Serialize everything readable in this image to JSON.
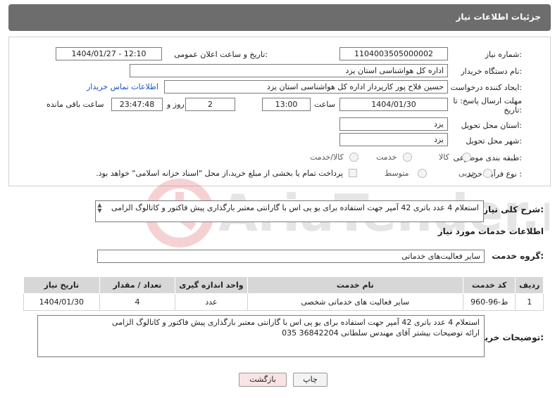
{
  "header": {
    "title": "جزئیات اطلاعات نیاز"
  },
  "form": {
    "need_number": {
      "label": "شماره نیاز:",
      "value": "1104003505000002"
    },
    "announce_datetime": {
      "label": "تاریخ و ساعت اعلان عمومی:",
      "value": "1404/01/27 - 12:10"
    },
    "buyer_org": {
      "label": "نام دستگاه خریدار:",
      "value": "اداره کل هواشناسی استان یزد"
    },
    "requester": {
      "label": "ایجاد کننده درخواست:",
      "value": "حسین  فلاح پور کارپرداز اداره کل هواشناسی استان یزد",
      "contact_link": "اطلاعات تماس خریدار"
    },
    "deadline": {
      "label_line1": "مهلت ارسال پاسخ: تا",
      "label_line2": "تاریخ:",
      "date": "1404/01/30",
      "time_label": "ساعت",
      "time": "13:00",
      "days": "2",
      "days_label": "روز و",
      "remaining": "23:47:48",
      "remaining_label": "ساعت باقی مانده"
    },
    "delivery_province": {
      "label": "استان محل تحویل:",
      "value": "یزد"
    },
    "delivery_city": {
      "label": "شهر محل تحویل:",
      "value": "یزد"
    },
    "category": {
      "label": "طبقه بندی موضوعی:",
      "options": [
        "کالا",
        "خدمت",
        "کالا/خدمت"
      ]
    },
    "process_type": {
      "label": "نوع فرآیند خرید :",
      "options": [
        "جزیی",
        "متوسط"
      ],
      "payment_note": "پرداخت تمام یا بخشی از مبلغ خرید،از محل \"اسناد خزانه اسلامی\" خواهد بود."
    }
  },
  "summary": {
    "label": "شرح کلی نیاز:",
    "text": "استعلام 4 عدد باتری 42 آمپر  جهت استفاده برای یو پی اس با گارانتی معتبر بارگذاری پیش فاکتور و کاتالوگ الزامی"
  },
  "services_section": {
    "title": "اطلاعات خدمات مورد نیاز",
    "group_label": "گروه خدمت:",
    "group_value": "سایر فعالیت‌های خدماتی"
  },
  "table": {
    "headers": [
      "ردیف",
      "کد خدمت",
      "نام خدمت",
      "واحد اندازه گیری",
      "تعداد / مقدار",
      "تاریخ نیاز"
    ],
    "rows": [
      [
        "1",
        "ط-96-960",
        "سایر فعالیت های خدماتی شخصی",
        "عدد",
        "4",
        "1404/01/30"
      ]
    ]
  },
  "buyer_notes": {
    "label": "توضیحات خریدار:",
    "line1": "استعلام 4 عدد باتری 42 آمپر  جهت استفاده برای یو پی اس با گارانتی معتبر بارگذاری پیش فاکتور و کاتالوگ الزامی",
    "line2": "ارائه توضیحات بیشتر آقای مهندس سلطانی 36842204 035"
  },
  "buttons": {
    "print": "چاپ",
    "back": "بازگشت"
  },
  "watermark": {
    "text": "AriaTender.neT"
  },
  "colors": {
    "header_bg": "#6d6d6d",
    "link": "#1a53c4",
    "table_header": "#d7d7d7",
    "back_btn": "#fbe3e3"
  }
}
